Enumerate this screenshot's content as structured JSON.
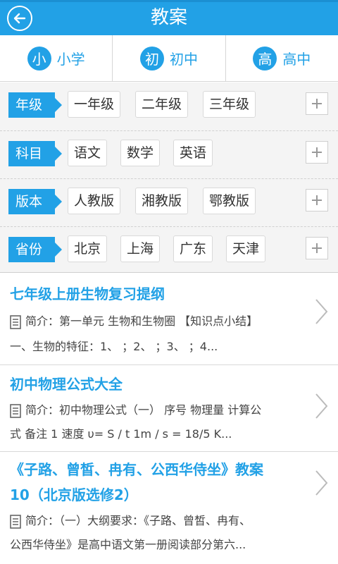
{
  "header": {
    "title": "教案",
    "back_icon": "back-arrow-icon"
  },
  "levels": [
    {
      "badge": "小",
      "label": "小学"
    },
    {
      "badge": "初",
      "label": "初中"
    },
    {
      "badge": "高",
      "label": "高中"
    }
  ],
  "filters": [
    {
      "tag": "年级",
      "options": [
        "一年级",
        "二年级",
        "三年级"
      ]
    },
    {
      "tag": "科目",
      "options": [
        "语文",
        "数学",
        "英语"
      ]
    },
    {
      "tag": "版本",
      "options": [
        "人教版",
        "湘教版",
        "鄂教版"
      ]
    },
    {
      "tag": "省份",
      "options": [
        "北京",
        "上海",
        "广东",
        "天津"
      ]
    }
  ],
  "articles": [
    {
      "title": "七年级上册生物复习提纲",
      "desc_line1": "简介：第一单元 生物和生物圈 【知识点小结】",
      "desc_line2": "一、生物的特征：1、 ；2、 ；3、 ；4..."
    },
    {
      "title": "初中物理公式大全",
      "desc_line1": "简介：初中物理公式（一） 序号 物理量 计算公",
      "desc_line2": "式 备注 1 速度 υ= S / t 1m / s = 18/5 K..."
    },
    {
      "title_line1": "《子路、曾皙、冉有、公西华侍坐》教案",
      "title_line2": "10（北京版选修2）",
      "desc_line1": "简介：（一）大纲要求：《子路、曾皙、冉有、",
      "desc_line2": "公西华侍坐》是高中语文第一册阅读部分第六..."
    }
  ],
  "colors": {
    "accent": "#22a1e6",
    "filter_bg": "#f4f4f4"
  }
}
